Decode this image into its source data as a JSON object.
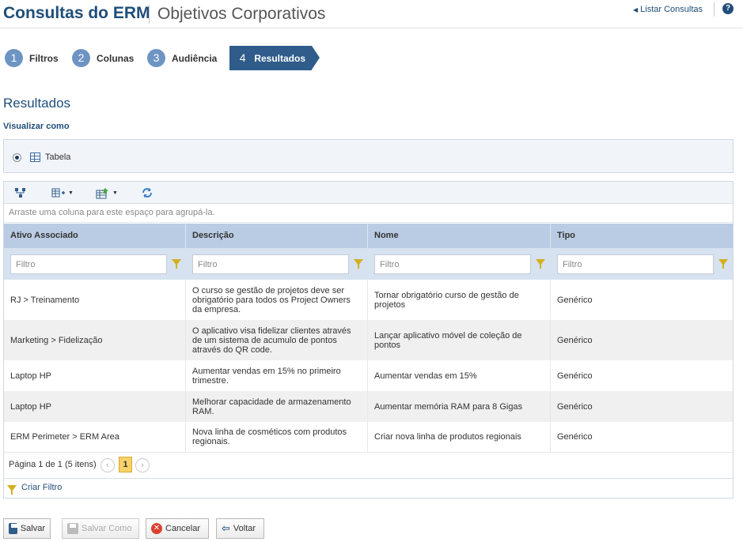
{
  "header": {
    "app_title": "Consultas do ERM",
    "page_title": "Objetivos Corporativos",
    "list_link": "Listar Consultas",
    "help_icon": "?"
  },
  "wizard": {
    "steps": [
      {
        "num": "1",
        "label": "Filtros"
      },
      {
        "num": "2",
        "label": "Colunas"
      },
      {
        "num": "3",
        "label": "Audiência"
      },
      {
        "num": "4",
        "label": "Resultados",
        "active": true
      }
    ]
  },
  "results": {
    "title": "Resultados",
    "view_as_label": "Visualizar como",
    "view_option": "Tabela"
  },
  "grid": {
    "toolbar_icons": [
      "hierarchy-icon",
      "columns-icon",
      "export-icon",
      "refresh-icon"
    ],
    "group_hint": "Arraste uma coluna para este espaço para agrupá-la.",
    "columns": [
      "Ativo Associado",
      "Descrição",
      "Nome",
      "Tipo"
    ],
    "filter_placeholder": "Filtro",
    "rows": [
      {
        "ativo": "RJ > Treinamento",
        "descricao": "O curso se gestão de projetos deve ser obrigatório para todos os Project Owners da empresa.",
        "nome": "Tornar obrigatório curso de gestão de projetos",
        "tipo": "Genérico"
      },
      {
        "ativo": "Marketing > Fidelização",
        "descricao": "O aplicativo visa fidelizar clientes através de um sistema de acumulo de pontos através do QR code.",
        "nome": "Lançar aplicativo móvel de coleção de pontos",
        "tipo": "Genérico"
      },
      {
        "ativo": "Laptop HP",
        "descricao": "Aumentar vendas em 15% no primeiro trimestre.",
        "nome": "Aumentar vendas em 15%",
        "tipo": "Genérico"
      },
      {
        "ativo": "Laptop HP",
        "descricao": "Melhorar capacidade de armazenamento RAM.",
        "nome": "Aumentar memória RAM para 8 Gigas",
        "tipo": "Genérico"
      },
      {
        "ativo": "ERM Perimeter > ERM Area",
        "descricao": "Nova linha de cosméticos com produtos regionais.",
        "nome": "Criar nova linha de produtos regionais",
        "tipo": "Genérico"
      }
    ],
    "pager": {
      "text": "Página 1 de 1 (5 itens)",
      "prev": "‹",
      "current": "1",
      "next": "›"
    },
    "create_filter": "Criar Filtro"
  },
  "actions": {
    "save": "Salvar",
    "save_as": "Salvar Como",
    "cancel": "Cancelar",
    "back": "Voltar"
  },
  "colors": {
    "brand": "#1f4e79",
    "active_step": "#2f5c8a",
    "header_row": "#b9cce3",
    "filter_row": "#d6e2ef",
    "page_highlight": "#f7d26a"
  }
}
